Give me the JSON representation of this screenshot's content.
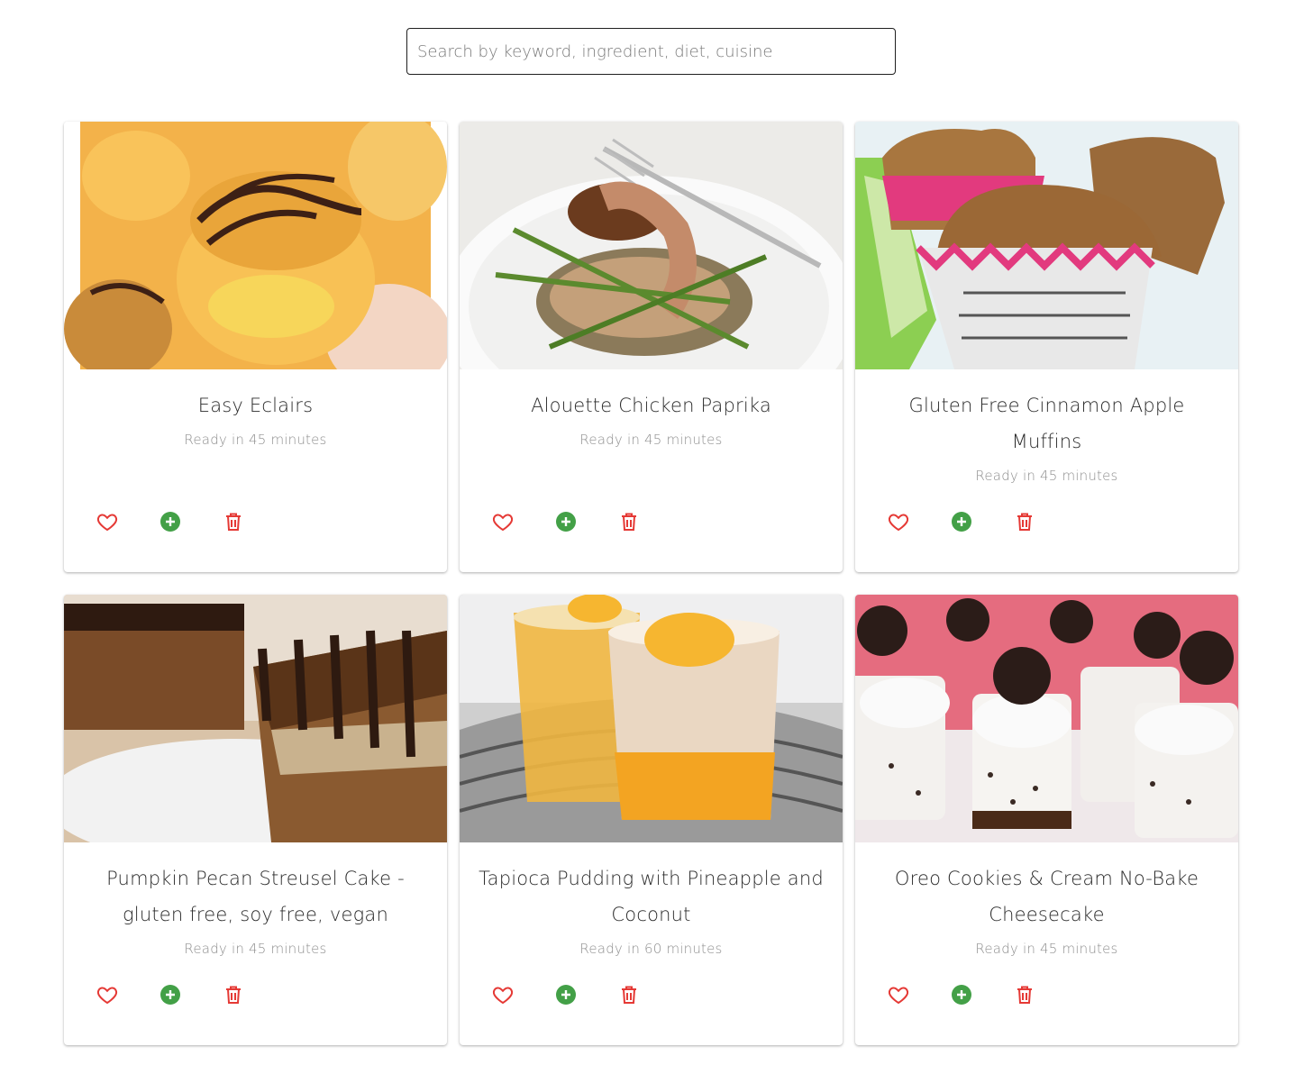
{
  "search": {
    "placeholder": "Search by keyword, ingredient, diet, cuisine"
  },
  "colors": {
    "heart": "#e53935",
    "add": "#43a047",
    "delete": "#e53935",
    "border": "#1f1f1f"
  },
  "icons": {
    "favorite": "heart-outline-icon",
    "add": "add-circle-icon",
    "delete": "trash-icon"
  },
  "recipes": [
    {
      "title": "Easy Eclairs",
      "ready": "Ready in 45 minutes",
      "image": "eclairs-photo"
    },
    {
      "title": "Alouette Chicken Paprika",
      "ready": "Ready in 45 minutes",
      "image": "chicken-paprika-photo"
    },
    {
      "title": "Gluten Free Cinnamon Apple Muffins",
      "ready": "Ready in 45 minutes",
      "image": "apple-muffins-photo"
    },
    {
      "title": "Pumpkin Pecan Streusel Cake - gluten free, soy free, vegan",
      "ready": "Ready in 45 minutes",
      "image": "streusel-cake-photo"
    },
    {
      "title": "Tapioca Pudding with Pineapple and Coconut",
      "ready": "Ready in 60 minutes",
      "image": "tapioca-pudding-photo"
    },
    {
      "title": "Oreo Cookies & Cream No-Bake Cheesecake",
      "ready": "Ready in 45 minutes",
      "image": "oreo-cheesecake-photo"
    }
  ]
}
